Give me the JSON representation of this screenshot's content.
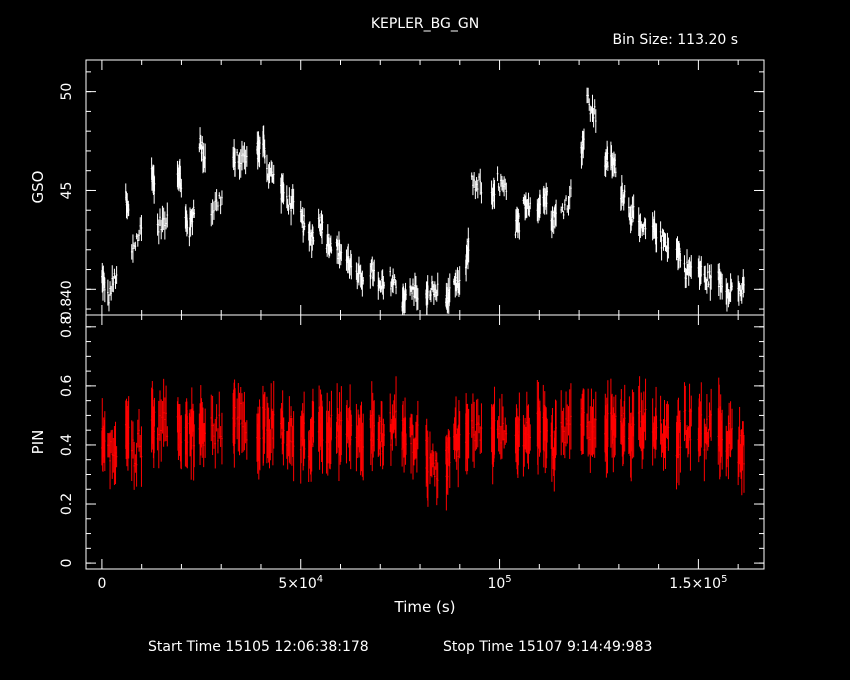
{
  "chart_data": [
    {
      "type": "line",
      "title": "KEPLER_BG_GN",
      "subtitle": "Bin Size: 113.20 s",
      "xlabel": "Time (s)",
      "ylabel": "GSO",
      "color": "#ffffff",
      "xlim": [
        -4000,
        166500
      ],
      "ylim": [
        38.7,
        51.6
      ],
      "y_ticks": [
        "40",
        "45",
        "50"
      ],
      "y_tick_values": [
        40,
        45,
        50
      ],
      "y_edge_label": "0.8",
      "x": [
        0,
        1500,
        6000,
        7500,
        12500,
        14000,
        19000,
        21000,
        22000,
        24500,
        27500,
        33000,
        34000,
        39000,
        40500,
        41500,
        45000,
        46500,
        50000,
        52000,
        54500,
        56500,
        59000,
        61500,
        64000,
        67500,
        69500,
        72500,
        75500,
        77500,
        81500,
        82500,
        86500,
        88500,
        91500,
        93000,
        98000,
        99500,
        104000,
        106000,
        109500,
        111000,
        113000,
        115500,
        120500,
        122000,
        126500,
        128000,
        130500,
        132500,
        135000,
        138500,
        140500,
        144500,
        146500,
        150000,
        151500,
        155000,
        157000,
        160000,
        163000
      ],
      "y": [
        40.5,
        39.5,
        44.5,
        42.0,
        46.0,
        43.0,
        46.0,
        43.5,
        43.0,
        47.5,
        44.0,
        46.5,
        46.5,
        47.0,
        47.5,
        46.0,
        45.0,
        44.5,
        43.5,
        42.5,
        43.5,
        42.5,
        42.0,
        41.5,
        40.5,
        41.0,
        40.0,
        40.5,
        39.5,
        40.0,
        39.5,
        40.0,
        39.5,
        40.0,
        41.0,
        45.5,
        44.5,
        45.5,
        43.0,
        44.5,
        44.0,
        45.0,
        43.5,
        44.0,
        47.0,
        49.5,
        46.5,
        46.5,
        45.0,
        44.0,
        43.0,
        43.0,
        42.5,
        42.0,
        41.0,
        41.0,
        40.5,
        40.5,
        40.0,
        40.0,
        39.5
      ]
    },
    {
      "type": "line",
      "xlabel": "Time (s)",
      "ylabel": "PIN",
      "color": "#ff0000",
      "xlim": [
        -4000,
        166500
      ],
      "ylim": [
        -0.02,
        0.84
      ],
      "y_ticks": [
        "0",
        "0.2",
        "0.4",
        "0.6",
        "0.8"
      ],
      "y_tick_values": [
        0,
        0.2,
        0.4,
        0.6,
        0.8
      ],
      "x_ticks": [
        {
          "value": 0,
          "mantissa": "0",
          "exponent": ""
        },
        {
          "value": 50000,
          "mantissa": "5×10",
          "exponent": "4"
        },
        {
          "value": 100000,
          "mantissa": "10",
          "exponent": "5"
        },
        {
          "value": 150000,
          "mantissa": "1.5×10",
          "exponent": "5"
        }
      ],
      "x": [
        0,
        1500,
        6000,
        7500,
        12500,
        14000,
        19000,
        21000,
        22000,
        24500,
        27500,
        33000,
        34000,
        39000,
        40500,
        41500,
        45000,
        46500,
        50000,
        52000,
        54500,
        56500,
        59000,
        61500,
        64000,
        67500,
        69500,
        72500,
        75500,
        77500,
        81500,
        82500,
        86500,
        88500,
        91500,
        93000,
        98000,
        99500,
        104000,
        106000,
        109500,
        111000,
        113000,
        115500,
        120500,
        122000,
        126500,
        128000,
        130500,
        132500,
        135000,
        138500,
        140500,
        144500,
        146500,
        150000,
        151500,
        155000,
        157000,
        160000,
        163000
      ],
      "y": [
        0.42,
        0.36,
        0.45,
        0.38,
        0.47,
        0.45,
        0.46,
        0.42,
        0.44,
        0.45,
        0.46,
        0.48,
        0.49,
        0.44,
        0.47,
        0.45,
        0.46,
        0.44,
        0.43,
        0.42,
        0.47,
        0.44,
        0.45,
        0.46,
        0.43,
        0.45,
        0.42,
        0.46,
        0.44,
        0.43,
        0.36,
        0.33,
        0.34,
        0.4,
        0.44,
        0.45,
        0.43,
        0.46,
        0.44,
        0.42,
        0.45,
        0.44,
        0.38,
        0.46,
        0.48,
        0.46,
        0.44,
        0.47,
        0.45,
        0.44,
        0.48,
        0.45,
        0.44,
        0.42,
        0.46,
        0.47,
        0.44,
        0.46,
        0.42,
        0.4,
        0.38
      ]
    }
  ],
  "footer": {
    "start": "Start Time 15105 12:06:38:178",
    "stop": "Stop Time 15107  9:14:49:983"
  }
}
